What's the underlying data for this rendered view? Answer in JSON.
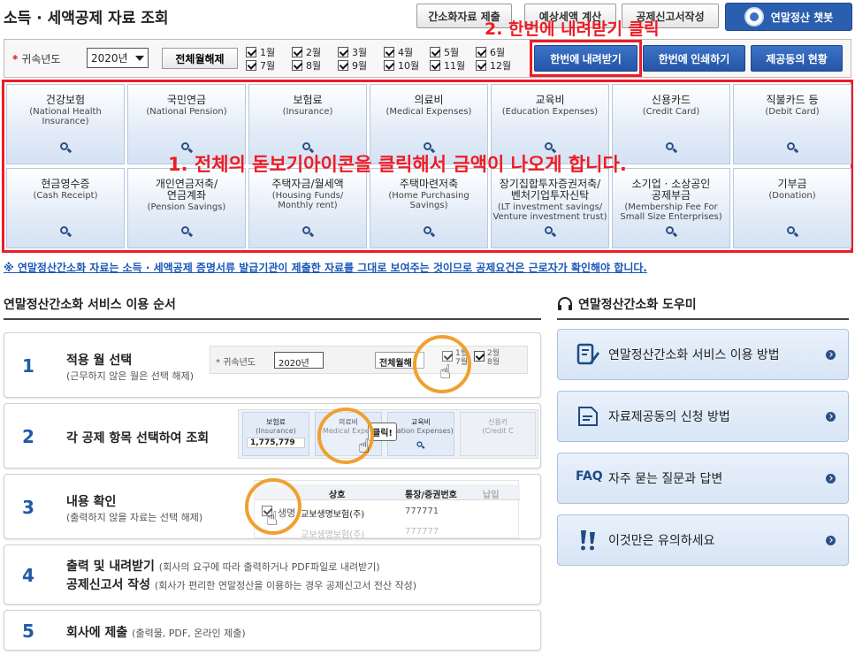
{
  "header": {
    "title": "소득 · 세액공제 자료 조회",
    "buttons": [
      "간소화자료 제출",
      "예상세액 계산",
      "공제신고서작성"
    ],
    "chatbot_label": "연말정산 챗봇"
  },
  "annotations": {
    "step2": "2. 한번에 내려받기 클릭",
    "step1": "1. 전체의 돋보기아이콘을 클릭해서 금액이 나오게 합니다."
  },
  "filter": {
    "year_label": "귀속년도",
    "year_value": "2020년",
    "clear_button": "전체월해제",
    "months": [
      "1월",
      "2월",
      "3월",
      "4월",
      "5월",
      "6월",
      "7월",
      "8월",
      "9월",
      "10월",
      "11월",
      "12월"
    ],
    "download_button": "한번에 내려받기",
    "print_button": "한번에 인쇄하기",
    "provider_button": "제공동의 현황"
  },
  "categories": [
    {
      "ko": "건강보험",
      "en": "(National Health Insurance)"
    },
    {
      "ko": "국민연금",
      "en": "(National Pension)"
    },
    {
      "ko": "보험료",
      "en": "(Insurance)"
    },
    {
      "ko": "의료비",
      "en": "(Medical Expenses)"
    },
    {
      "ko": "교육비",
      "en": "(Education Expenses)"
    },
    {
      "ko": "신용카드",
      "en": "(Credit Card)"
    },
    {
      "ko": "직불카드 등",
      "en": "(Debit Card)"
    },
    {
      "ko": "현금영수증",
      "en": "(Cash Receipt)"
    },
    {
      "ko": "개인연금저축/\n연금계좌",
      "en": "(Pension Savings)"
    },
    {
      "ko": "주택자금/월세액",
      "en": "(Housing Funds/\nMonthly rent)"
    },
    {
      "ko": "주택마련저축",
      "en": "(Home Purchasing Savings)"
    },
    {
      "ko": "장기집합투자증권저축/\n벤처기업투자신탁",
      "en": "(LT investment savings/\nVenture investment trust)"
    },
    {
      "ko": "소기업 · 소상공인\n공제부금",
      "en": "(Membership Fee For\nSmall Size Enterprises)"
    },
    {
      "ko": "기부금",
      "en": "(Donation)"
    }
  ],
  "notice": "※ 연말정산간소화 자료는 소득 · 세액공제 증명서류 발급기관이 제출한 자료를 그대로 보여주는 것이므로 공제요건은 근로자가 확인해야 합니다.",
  "guide": {
    "title": "연말정산간소화 서비스 이용 순서",
    "steps": [
      {
        "num": "1",
        "title": "적용 월 선택",
        "desc": "(근무하지 않은 월은 선택 해제)"
      },
      {
        "num": "2",
        "title": "각 공제 항목 선택하여 조회",
        "desc": ""
      },
      {
        "num": "3",
        "title": "내용 확인",
        "desc": "(출력하지 않을 자료는 선택 해제)"
      },
      {
        "num": "4",
        "title": "출력 및 내려받기",
        "title2": "공제신고서 작성",
        "desc": "(회사의 요구에 따라 출력하거나 PDF파일로 내려받기)",
        "desc2": "(회사가 편리한 연말정산을 이용하는 경우 공제신고서 전산 작성)"
      },
      {
        "num": "5",
        "title": "회사에 제출",
        "desc": "(출력물, PDF, 온라인 제출)"
      }
    ],
    "illus1": {
      "year_label": "귀속년도",
      "year_value": "2020년",
      "clear": "전체월해",
      "m1": "1월",
      "m7": "7월",
      "m2": "2월",
      "m8": "8월"
    },
    "illus2": {
      "tile1_ko": "보험료",
      "tile1_en": "(Insurance)",
      "tile1_amount": "1,775,779",
      "tile2_ko": "의료비",
      "tile2_en": "Medical Expen",
      "tile3_ko": "교육비",
      "tile3_en": "ucation Expenses)",
      "tile4_ko": "신용카",
      "tile4_en": "(Credit C",
      "click": "클릭!"
    },
    "illus3": {
      "col1": "상호",
      "col2": "통장/증권번호",
      "col3": "납입",
      "row1_name": "생명",
      "row1_company": "교보생명보험(주)",
      "row1_number": "777771",
      "row2_company": "교보생명보험(주)",
      "row2_number": "777777"
    }
  },
  "helper": {
    "title": "연말정산간소화 도우미",
    "items": [
      {
        "icon": "edit-icon",
        "label": "연말정산간소화 서비스 이용 방법"
      },
      {
        "icon": "document-icon",
        "label": "자료제공동의 신청 방법"
      },
      {
        "icon": "faq-icon",
        "label": "자주 묻는 질문과 답변",
        "prefix": "FAQ"
      },
      {
        "icon": "warning-icon",
        "label": "이것만은 유의하세요"
      }
    ]
  },
  "colors": {
    "accent": "#2555a6",
    "annotation": "#ee1c25",
    "notice": "#1a58b8"
  }
}
